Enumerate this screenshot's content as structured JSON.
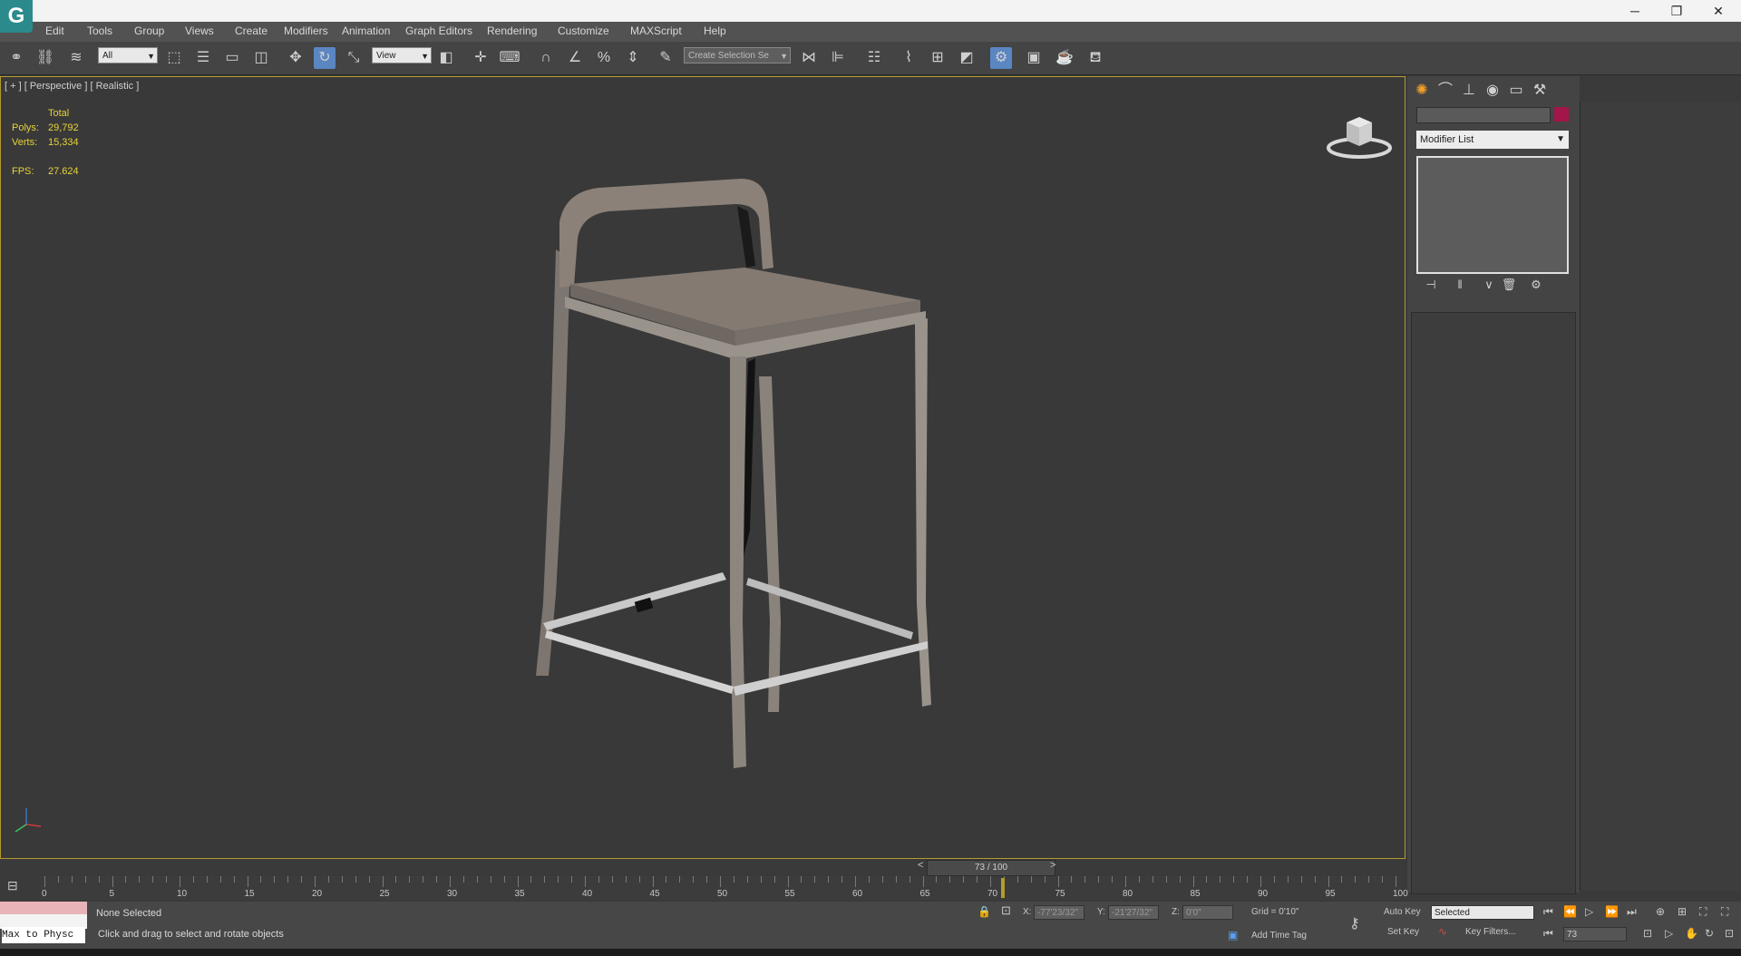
{
  "titlebar": {
    "logo_glyph": "G",
    "minimize": "─",
    "restore": "❐",
    "close": "✕"
  },
  "menu": [
    "Edit",
    "Tools",
    "Group",
    "Views",
    "Create",
    "Modifiers",
    "Animation",
    "Graph Editors",
    "Rendering",
    "Customize",
    "MAXScript",
    "Help"
  ],
  "toolbar": {
    "selection_filter": "All",
    "reference_coord": "View",
    "named_selection": "Create Selection Se"
  },
  "viewport": {
    "label": "[ + ] [ Perspective ] [ Realistic ]",
    "stats": {
      "total_label": "Total",
      "polys_label": "Polys:",
      "polys_value": "29,792",
      "verts_label": "Verts:",
      "verts_value": "15,334",
      "fps_label": "FPS:",
      "fps_value": "27.624"
    }
  },
  "command_panel": {
    "modifier_list": "Modifier List",
    "swatch_color": "#a3164a"
  },
  "timeline": {
    "current": "73 / 100",
    "prev": "<",
    "next": ">",
    "ticks": [
      "0",
      "5",
      "10",
      "15",
      "20",
      "25",
      "30",
      "35",
      "40",
      "45",
      "50",
      "55",
      "60",
      "65",
      "70",
      "75",
      "80",
      "85",
      "90",
      "95",
      "100"
    ]
  },
  "statusbar": {
    "maxscript": "Max to Physc",
    "selection": "None Selected",
    "prompt": "Click and drag to select and rotate objects",
    "x_label": "X:",
    "x_value": "-77'23/32\"",
    "y_label": "Y:",
    "y_value": "-21'27/32\"",
    "z_label": "Z:",
    "z_value": "0'0\"",
    "grid": "Grid = 0'10\"",
    "add_time_tag": "Add Time Tag",
    "auto_key": "Auto Key",
    "set_key": "Set Key",
    "key_mode": "Selected",
    "key_filters": "Key Filters...",
    "frame": "73"
  }
}
